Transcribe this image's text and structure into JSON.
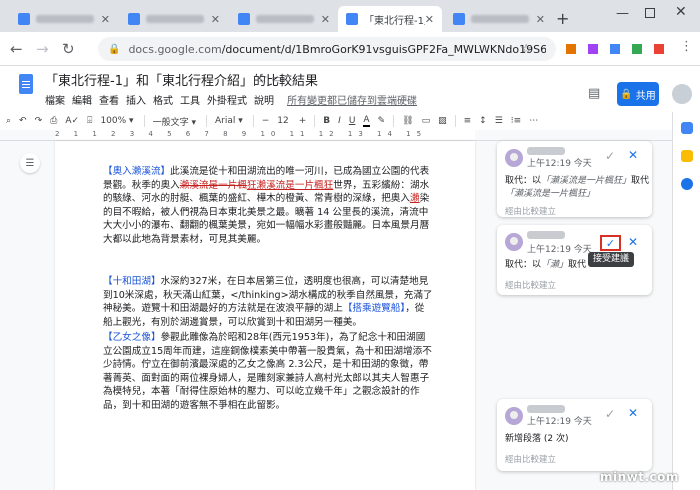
{
  "tabs": [
    {
      "fav_color": "#4285f4",
      "active": false
    },
    {
      "fav_color": "#4285f4",
      "active": false
    },
    {
      "fav_color": "#4285f4",
      "active": false
    },
    {
      "fav_color": "#4285f4",
      "active": true,
      "title": "「東北行程-1」和"
    },
    {
      "fav_color": "#4285f4",
      "active": false
    }
  ],
  "window": {
    "new_tab": "+",
    "minimize": "—",
    "close": "✕"
  },
  "address": {
    "host": "docs.google.com",
    "path": "/document/d/1BmroGorK91vsguisGPF2Fa_MWLWKNdo19S6g_W..."
  },
  "doc": {
    "title": "「東北行程-1」和「東北行程介紹」的比較結果",
    "menu": [
      "檔案",
      "編輯",
      "查看",
      "插入",
      "格式",
      "工具",
      "外掛程式",
      "說明"
    ],
    "last_edit": "所有變更都已儲存到雲端硬碟",
    "share_label": "共用"
  },
  "format_bar": {
    "zoom": "100%",
    "style": "一般文字",
    "font": "Arial",
    "size": "12"
  },
  "ruler_ticks": "2  1  1  2  3  4  5  6  7  8  9  10  11  12  13  14  15",
  "body": {
    "p1": {
      "kw": "【奧入瀨溪流】",
      "t1": "此溪流是從十和田湖流出的唯一河川，已成為國立公園的代表景觀。秋季的奧入",
      "del": "瀨溪流是一片楓",
      "ins": "狂瀨溪流是一片楓狂",
      "t2": "世界，五彩繽紛：湖水的駭綠、河水的肘艇、楓葉的盛紅、樺木的橙黃、常青樹的深綠，把奧入",
      "ins2": "瀨",
      "t3": "染的目不暇給，被人們視為日本東北美景之最。曠著 14 公里長的溪流，清流中大大小小的瀑布、翻翻的楓葉美景，宛如一幅幅水彩畫般豔麗。日本風景月曆大都以此地為背景素材，可見其美麗。"
    },
    "p2": {
      "kw": "【十和田湖】",
      "t1": "水深約327米，在日本居第三位，透明度也很高，可以清楚地見到10米深處，秋天滿山紅葉，</thinking>湖水構成的秋季自然風景，充滿了神秘美。遊覽十和田湖最好的方法就是在波浪平靜的湖上",
      "kw2": "【搭乘遊覽船】",
      "t2": "，從船上觀光，有別於湖邊賞景，可以欣賞到十和田湖另一種美。"
    },
    "p3": {
      "kw": "【乙女之像】",
      "t1": "參觀此雕像為於昭和28年(西元1953年)，為了紀念十和田湖國立公園成立15周年而建，這座銅像樸素美中帶著一股貴氣，為十和田湖增添不少詩情。佇立在御前濱最深處的乙女之像高 2.3公尺，是十和田湖的象徵，帶著菁英、面對面的兩位裸身婦人，是雕刻家兼詩人高村光太郎以其夫人智惠子為模特兒，本著「耐得住原始林的壓力、可以屹立幾千年」之觀念設計的作品，到十和田湖的遊客無不爭相在此留影。"
    }
  },
  "cards": [
    {
      "time": "上午12:19 今天",
      "line1_label": "取代：以",
      "line1_val": "「瀨溪流是一片楓狂」",
      "line1_tail": "取代",
      "line2_val": "「瀨溪流是一片楓狂」",
      "reply": "經由比較建立"
    },
    {
      "time": "上午12:19 今天",
      "line1_label": "取代：以",
      "line1_val": "「瀨」",
      "line1_tail": "取代「",
      "reply": "經由比較建立"
    },
    {
      "time": "上午12:19 今天",
      "line1_label": "新增段落 (2 次)",
      "reply": "經由比較建立"
    }
  ],
  "tooltip": "接受建議",
  "watermark": "minwt.com"
}
